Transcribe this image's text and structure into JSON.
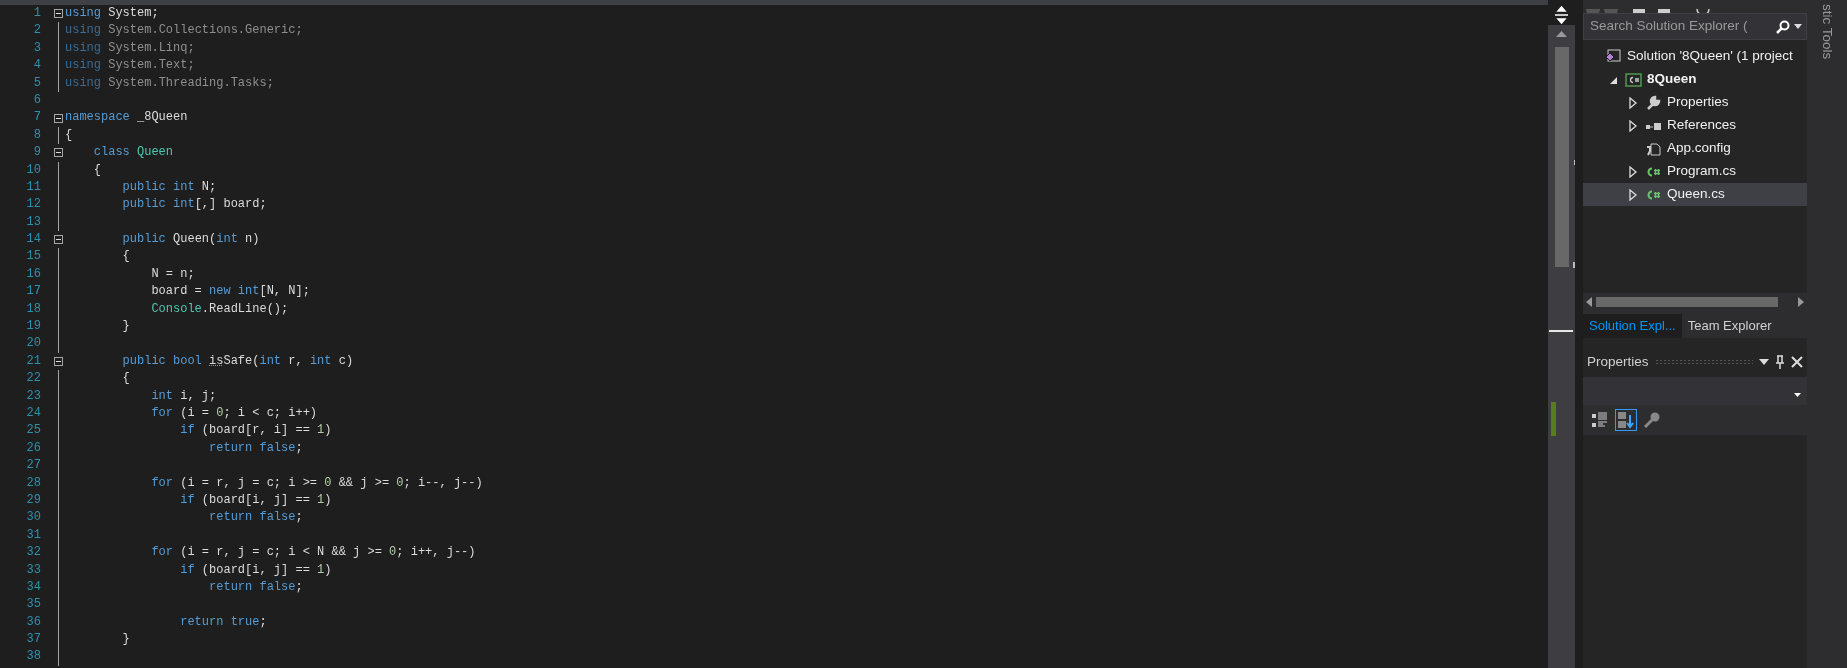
{
  "editor": {
    "lines": [
      {
        "number": "1",
        "collapsible": true,
        "tokens": [
          {
            "text": "using",
            "kind": "keyword"
          },
          {
            "text": " System;",
            "kind": "text"
          }
        ]
      },
      {
        "number": "2",
        "unused": true,
        "tokens": [
          {
            "text": "using",
            "kind": "keyword"
          },
          {
            "text": " System.Collections.Generic;",
            "kind": "text"
          }
        ]
      },
      {
        "number": "3",
        "unused": true,
        "tokens": [
          {
            "text": "using",
            "kind": "keyword"
          },
          {
            "text": " System.Linq;",
            "kind": "text"
          }
        ]
      },
      {
        "number": "4",
        "unused": true,
        "tokens": [
          {
            "text": "using",
            "kind": "keyword"
          },
          {
            "text": " System.Text;",
            "kind": "text"
          }
        ]
      },
      {
        "number": "5",
        "unused": true,
        "tokens": [
          {
            "text": "using",
            "kind": "keyword"
          },
          {
            "text": " System.Threading.Tasks;",
            "kind": "text"
          }
        ]
      },
      {
        "number": "6"
      },
      {
        "number": "7",
        "collapsible": true,
        "tokens": [
          {
            "text": "namespace",
            "kind": "keyword"
          },
          {
            "text": " _8Queen",
            "kind": "text"
          }
        ]
      },
      {
        "number": "8",
        "tokens": [
          {
            "text": "{",
            "kind": "text"
          }
        ]
      },
      {
        "number": "9",
        "collapsible": true,
        "tokens": [
          {
            "text": "    class",
            "kind": "keyword"
          },
          {
            "text": " Queen",
            "kind": "type"
          }
        ]
      },
      {
        "number": "10",
        "tokens": [
          {
            "text": "    {",
            "kind": "text"
          }
        ]
      },
      {
        "number": "11",
        "tokens": [
          {
            "text": "        public int",
            "kind": "keyword"
          },
          {
            "text": " N;",
            "kind": "text"
          }
        ]
      },
      {
        "number": "12",
        "tokens": [
          {
            "text": "        public int",
            "kind": "keyword"
          },
          {
            "text": "[,] board;",
            "kind": "text"
          }
        ]
      },
      {
        "number": "13"
      },
      {
        "number": "14",
        "collapsible": true,
        "tokens": [
          {
            "text": "        public",
            "kind": "keyword"
          },
          {
            "text": " Queen(",
            "kind": "text"
          },
          {
            "text": "int",
            "kind": "keyword"
          },
          {
            "text": " n)",
            "kind": "text"
          }
        ]
      },
      {
        "number": "15",
        "tokens": [
          {
            "text": "        {",
            "kind": "text"
          }
        ]
      },
      {
        "number": "16",
        "tokens": [
          {
            "text": "            N = n;",
            "kind": "text"
          }
        ]
      },
      {
        "number": "17",
        "tokens": [
          {
            "text": "            board = ",
            "kind": "text"
          },
          {
            "text": "new int",
            "kind": "keyword"
          },
          {
            "text": "[N, N];",
            "kind": "text"
          }
        ]
      },
      {
        "number": "18",
        "tokens": [
          {
            "text": "            Console",
            "kind": "type"
          },
          {
            "text": ".ReadLine();",
            "kind": "text"
          }
        ]
      },
      {
        "number": "19",
        "tokens": [
          {
            "text": "        }",
            "kind": "text"
          }
        ]
      },
      {
        "number": "20"
      },
      {
        "number": "21",
        "collapsible": true,
        "tokens": [
          {
            "text": "        public bool ",
            "kind": "keyword"
          },
          {
            "text": "is",
            "kind": "suggestion"
          },
          {
            "text": "Safe(",
            "kind": "text"
          },
          {
            "text": "int",
            "kind": "keyword"
          },
          {
            "text": " r, ",
            "kind": "text"
          },
          {
            "text": "int",
            "kind": "keyword"
          },
          {
            "text": " c)",
            "kind": "text"
          }
        ]
      },
      {
        "number": "22",
        "tokens": [
          {
            "text": "        {",
            "kind": "text"
          }
        ]
      },
      {
        "number": "23",
        "tokens": [
          {
            "text": "            int",
            "kind": "keyword"
          },
          {
            "text": " i, j;",
            "kind": "text"
          }
        ]
      },
      {
        "number": "24",
        "tokens": [
          {
            "text": "            for",
            "kind": "keyword"
          },
          {
            "text": " (i = ",
            "kind": "text"
          },
          {
            "text": "0",
            "kind": "number"
          },
          {
            "text": "; i < c; i++)",
            "kind": "text"
          }
        ]
      },
      {
        "number": "25",
        "tokens": [
          {
            "text": "                if",
            "kind": "keyword"
          },
          {
            "text": " (board[r, i] == ",
            "kind": "text"
          },
          {
            "text": "1",
            "kind": "number"
          },
          {
            "text": ")",
            "kind": "text"
          }
        ]
      },
      {
        "number": "26",
        "tokens": [
          {
            "text": "                    return false",
            "kind": "keyword"
          },
          {
            "text": ";",
            "kind": "text"
          }
        ]
      },
      {
        "number": "27"
      },
      {
        "number": "28",
        "tokens": [
          {
            "text": "            for",
            "kind": "keyword"
          },
          {
            "text": " (i = r, j = c; i >= ",
            "kind": "text"
          },
          {
            "text": "0",
            "kind": "number"
          },
          {
            "text": " && j >= ",
            "kind": "text"
          },
          {
            "text": "0",
            "kind": "number"
          },
          {
            "text": "; i--, j--)",
            "kind": "text"
          }
        ]
      },
      {
        "number": "29",
        "tokens": [
          {
            "text": "                if",
            "kind": "keyword"
          },
          {
            "text": " (board[i, j] == ",
            "kind": "text"
          },
          {
            "text": "1",
            "kind": "number"
          },
          {
            "text": ")",
            "kind": "text"
          }
        ]
      },
      {
        "number": "30",
        "tokens": [
          {
            "text": "                    return false",
            "kind": "keyword"
          },
          {
            "text": ";",
            "kind": "text"
          }
        ]
      },
      {
        "number": "31"
      },
      {
        "number": "32",
        "tokens": [
          {
            "text": "            for",
            "kind": "keyword"
          },
          {
            "text": " (i = r, j = c; i < N && j >= ",
            "kind": "text"
          },
          {
            "text": "0",
            "kind": "number"
          },
          {
            "text": "; i++, j--)",
            "kind": "text"
          }
        ]
      },
      {
        "number": "33",
        "tokens": [
          {
            "text": "                if",
            "kind": "keyword"
          },
          {
            "text": " (board[i, j] == ",
            "kind": "text"
          },
          {
            "text": "1",
            "kind": "number"
          },
          {
            "text": ")",
            "kind": "text"
          }
        ]
      },
      {
        "number": "34",
        "tokens": [
          {
            "text": "                    return false",
            "kind": "keyword"
          },
          {
            "text": ";",
            "kind": "text"
          }
        ]
      },
      {
        "number": "35"
      },
      {
        "number": "36",
        "tokens": [
          {
            "text": "                return true",
            "kind": "keyword"
          },
          {
            "text": ";",
            "kind": "text"
          }
        ]
      },
      {
        "number": "37",
        "tokens": [
          {
            "text": "        }",
            "kind": "text"
          }
        ]
      },
      {
        "number": "38"
      }
    ]
  },
  "solution_explorer": {
    "search": {
      "placeholder": "Search Solution Explorer ("
    },
    "tree": [
      {
        "label": "Solution '8Queen' (1 project",
        "kind": "solution",
        "selected": false,
        "children": [
          {
            "label": "8Queen",
            "kind": "project",
            "expanded": true,
            "selected": false,
            "children": [
              {
                "label": "Properties",
                "kind": "properties",
                "expanded": false,
                "selected": false
              },
              {
                "label": "References",
                "kind": "references",
                "expanded": false,
                "selected": false
              },
              {
                "label": "App.config",
                "kind": "config",
                "selected": false
              },
              {
                "label": "Program.cs",
                "kind": "csharp",
                "expanded": false,
                "selected": false
              },
              {
                "label": "Queen.cs",
                "kind": "csharp",
                "expanded": false,
                "selected": true
              }
            ]
          }
        ]
      }
    ]
  },
  "tabs": [
    {
      "label": "Solution Expl...",
      "selected": true
    },
    {
      "label": "Team Explorer",
      "selected": false
    }
  ],
  "properties": {
    "title": "Properties",
    "toolbar": [
      {
        "kind": "categorized",
        "selected": false
      },
      {
        "kind": "alphabetical",
        "selected": true
      },
      {
        "kind": "property-pages",
        "selected": false
      }
    ]
  },
  "side_tab": {
    "label": "stic Tools"
  }
}
